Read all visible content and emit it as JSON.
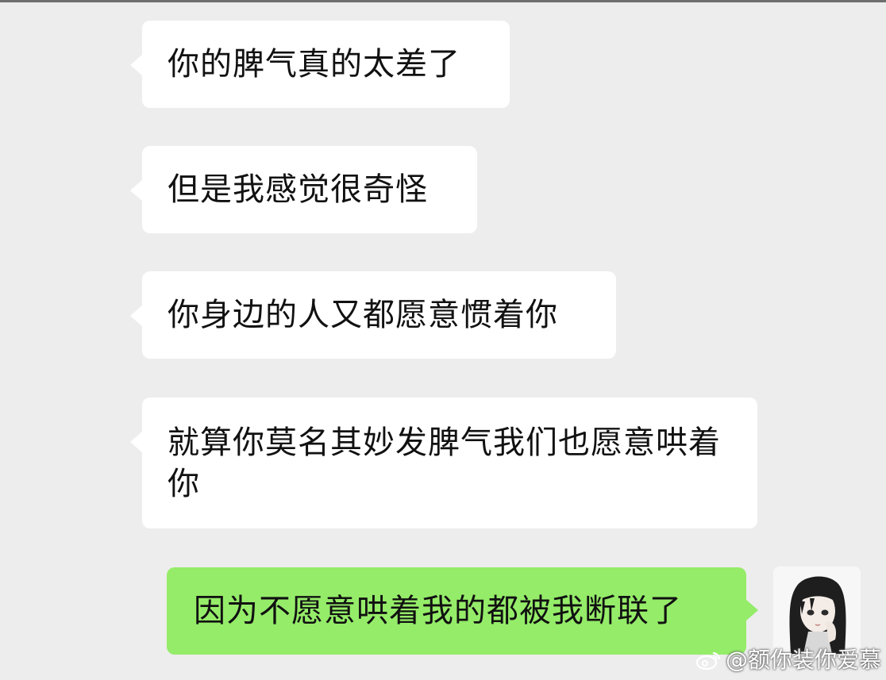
{
  "messages": [
    {
      "direction": "incoming",
      "text": "你的脾气真的太差了"
    },
    {
      "direction": "incoming",
      "text": "但是我感觉很奇怪"
    },
    {
      "direction": "incoming",
      "text": "你身边的人又都愿意惯着你"
    },
    {
      "direction": "incoming",
      "text": "就算你莫名其妙发脾气我们也愿意哄着你"
    },
    {
      "direction": "outgoing",
      "text": "因为不愿意哄着我的都被我断联了"
    }
  ],
  "avatar": {
    "icon": "girl-avatar-icon"
  },
  "watermark": {
    "icon": "weibo-logo-icon",
    "text": "@额你装你爱慕"
  },
  "colors": {
    "background": "#ededed",
    "incoming_bubble": "#ffffff",
    "outgoing_bubble": "#95ec69",
    "text": "#111111"
  }
}
